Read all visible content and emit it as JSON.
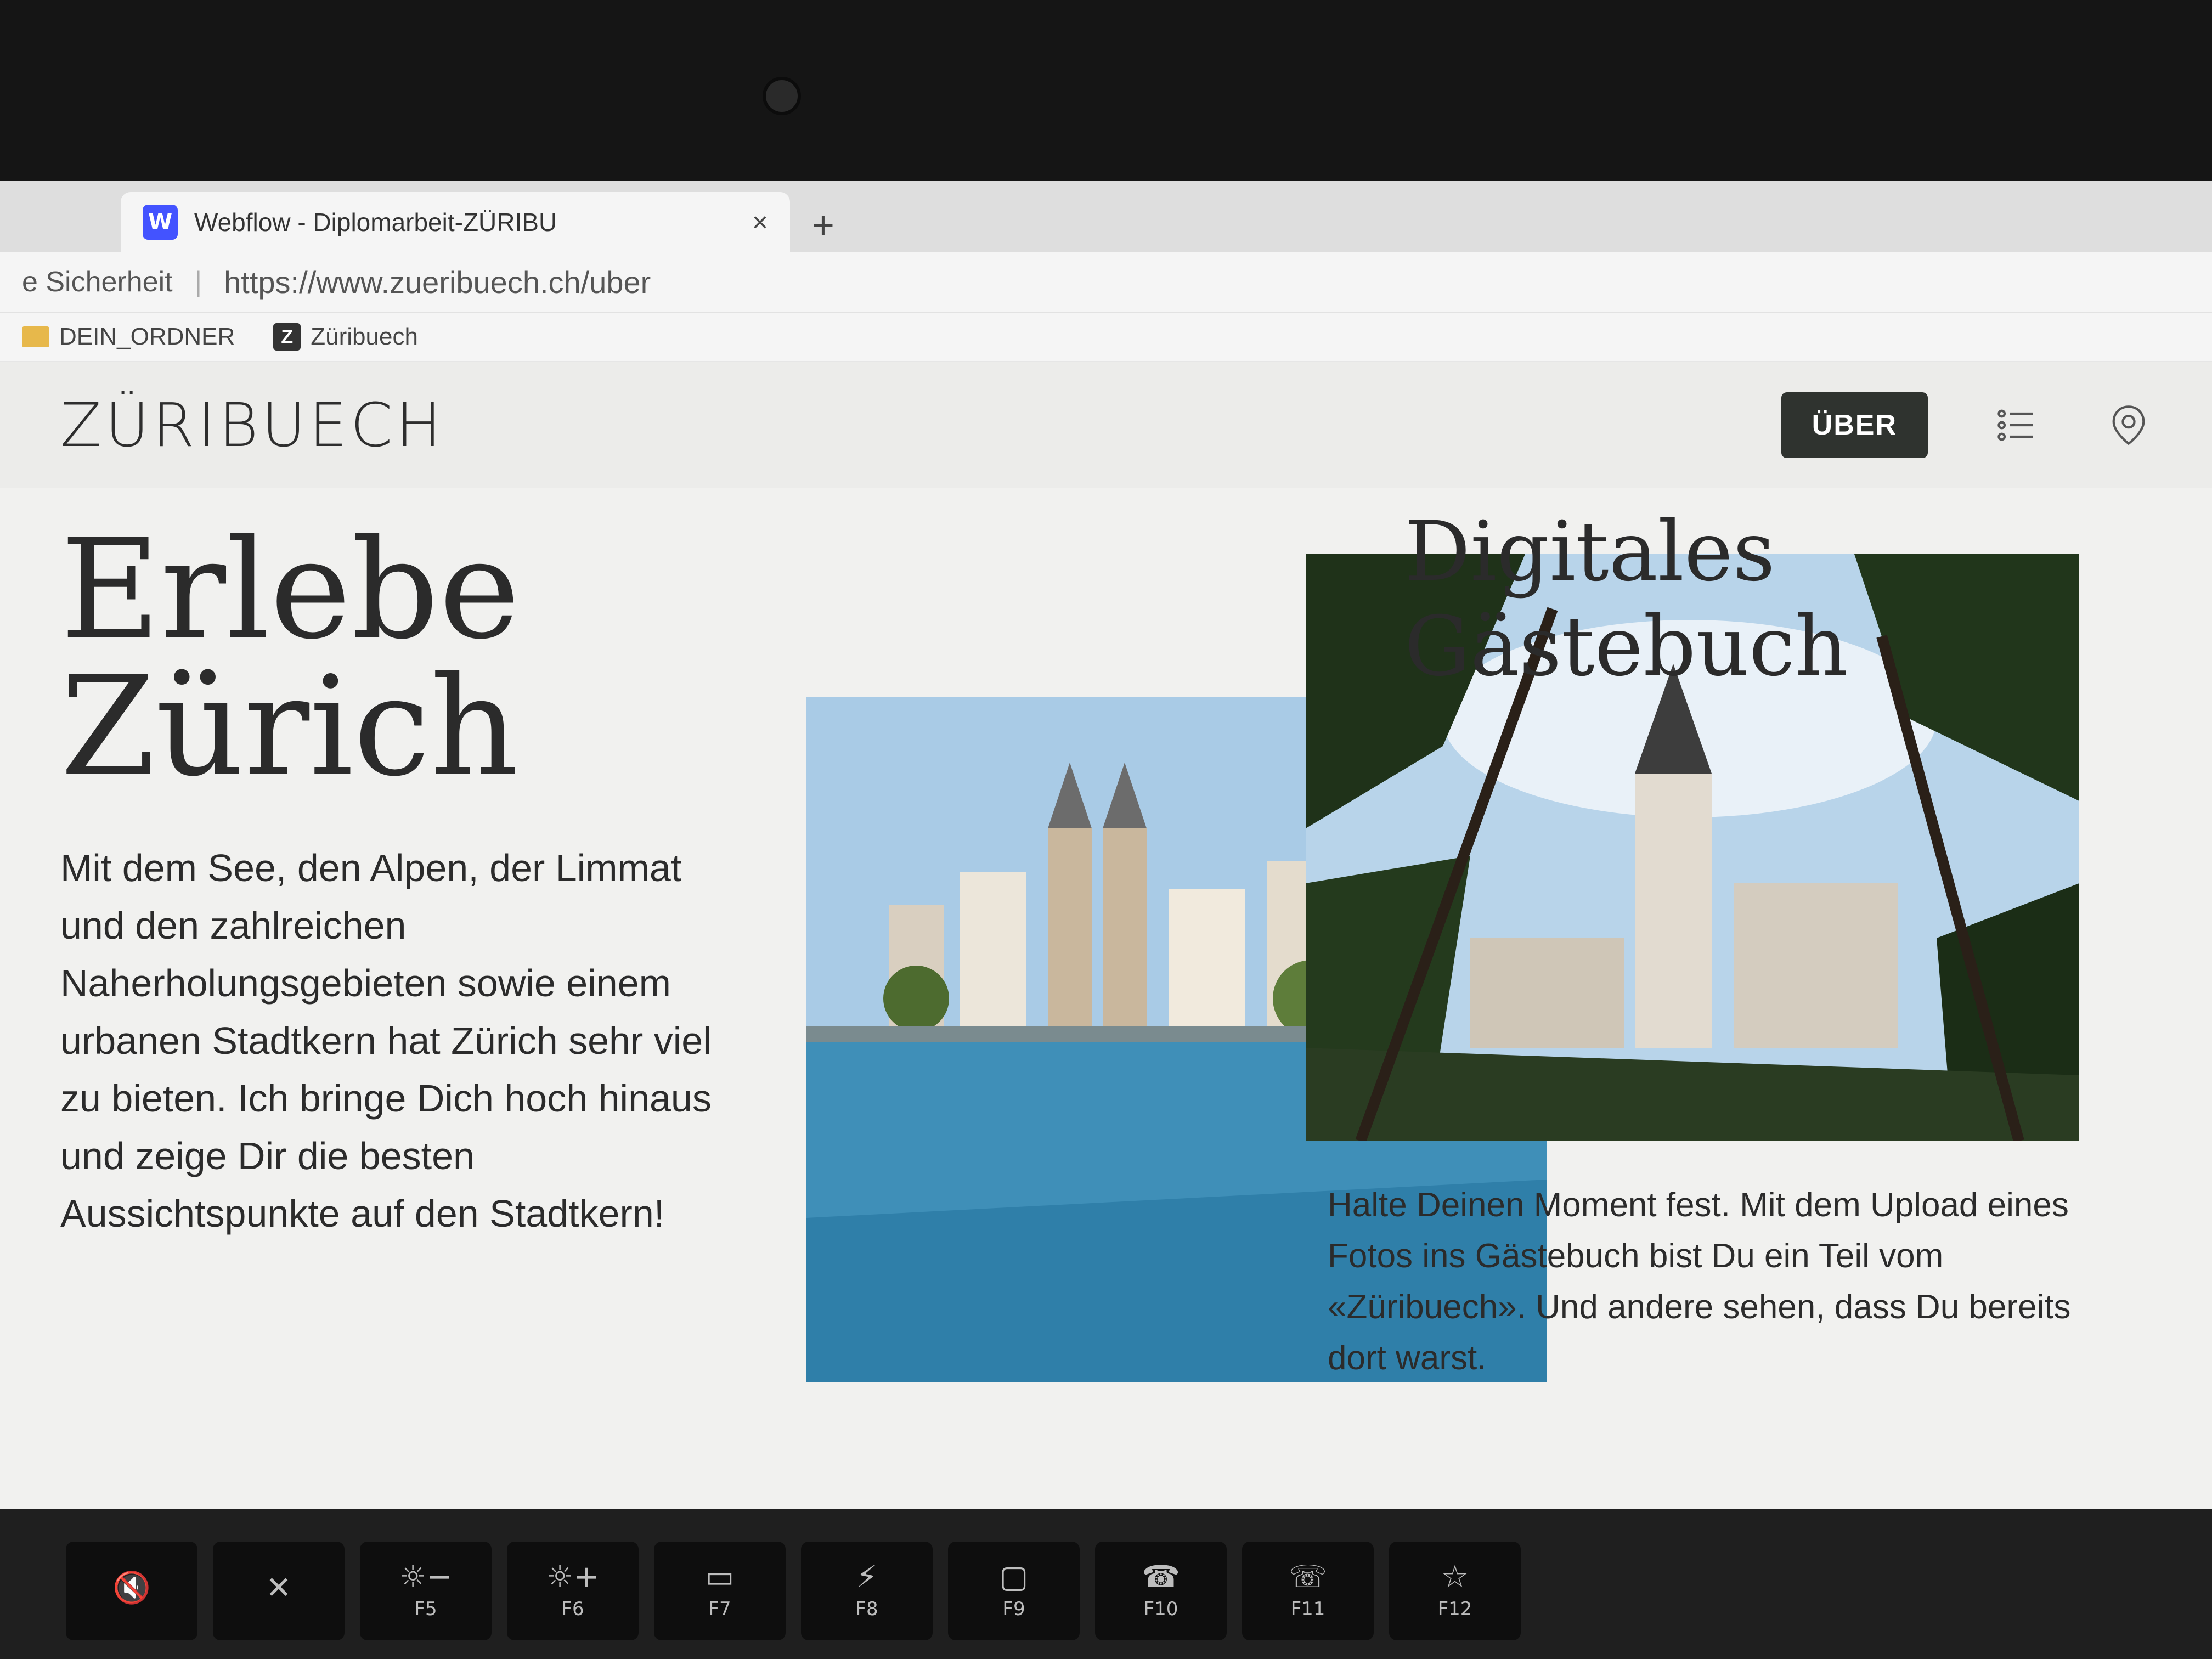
{
  "browser": {
    "tab": {
      "favicon": "W",
      "title": "Webflow - Diplomarbeit-ZÜRIBU",
      "close_label": "×",
      "new_tab_label": "+"
    },
    "address": {
      "security_text": "e Sicherheit",
      "separator": "|",
      "url": "https://www.zueribuech.ch/uber"
    },
    "bookmarks": [
      {
        "label": "DEIN_ORDNER",
        "icon": "folder-icon"
      },
      {
        "label": "Züribuech",
        "icon": "z-favicon-icon",
        "icon_text": "Z"
      }
    ]
  },
  "site": {
    "logo": "ZÜRIBUECH",
    "nav": {
      "uber_button": "ÜBER",
      "icons": [
        "list-icon",
        "location-pin-icon"
      ]
    },
    "hero": {
      "title": "Erlebe Zürich",
      "text": "Mit dem See, den Alpen, der Limmat und den zahlreichen Naherholungsgebieten sowie einem urbanen Stadtkern hat Zürich sehr viel zu bieten. Ich bringe Dich hoch hinaus und zeige Dir die besten Aussichtspunkte auf den Stadtkern!"
    },
    "guestbook": {
      "title": "Digitales Gästebuch",
      "text": "Halte Deinen Moment fest. Mit dem Upload eines Fotos ins Gästebuch bist Du ein Teil vom «Züribuech». Und andere sehen, dass Du bereits dort warst."
    }
  },
  "keyboard": {
    "keys": [
      {
        "symbol": "🔇",
        "label": ""
      },
      {
        "symbol": "✕",
        "label": ""
      },
      {
        "symbol": "☼−",
        "label": "F5"
      },
      {
        "symbol": "☼+",
        "label": "F6"
      },
      {
        "symbol": "▭",
        "label": "F7"
      },
      {
        "symbol": "⚡",
        "label": "F8"
      },
      {
        "symbol": "▢",
        "label": "F9"
      },
      {
        "symbol": "☎",
        "label": "F10"
      },
      {
        "symbol": "☏",
        "label": "F11"
      },
      {
        "symbol": "☆",
        "label": "F12"
      }
    ]
  }
}
